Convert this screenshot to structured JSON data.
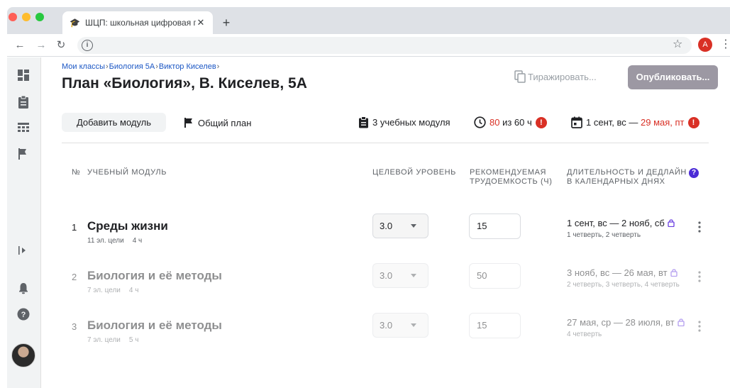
{
  "browser": {
    "tab_title": "ШЦП: школьная цифровая пл…",
    "tab_favicon": "graduate-icon",
    "profile_initial": "A",
    "profile_color": "#d93025"
  },
  "breadcrumbs": [
    {
      "label": "Мои классы"
    },
    {
      "label": "Биология 5А"
    },
    {
      "label": "Виктор Киселев"
    }
  ],
  "breadcrumb_separator": "›",
  "page_title": "План «Биология», В. Киселев, 5А",
  "actions": {
    "duplicate_label": "Тиражировать...",
    "publish_label": "Опубликовать...",
    "add_module_label": "Добавить модуль",
    "overall_plan_label": "Общий план"
  },
  "stats": {
    "modules": "3 учебных модуля",
    "hours_used": "80",
    "hours_of": "из 60 ч",
    "dates_start": "1 сент, вс —",
    "dates_end": "29 мая, пт",
    "error_mark": "!"
  },
  "table": {
    "headers": {
      "num": "№",
      "module": "Учебный модуль",
      "level": "Целевой уровень",
      "hours": "Рекомендуемая трудоемкость (ч)",
      "duration": "Длительность и дедлайн в календарных днях"
    },
    "help_mark": "?",
    "rows": [
      {
        "num": "1",
        "name": "Среды жизни",
        "goals": "11 эл. цели",
        "hours_meta": "4 ч",
        "level": "3.0",
        "hours": "15",
        "dates": "1 сент, вс — 2 нояб, сб",
        "quarters": "1 четверть, 2 четверть"
      },
      {
        "num": "2",
        "name": "Биология и её методы",
        "goals": "7 эл. цели",
        "hours_meta": "4 ч",
        "level": "3.0",
        "hours": "50",
        "dates": "3 нояб, вс — 26 мая, вт",
        "quarters": "2 четверть, 3 четверть, 4 четверть"
      },
      {
        "num": "3",
        "name": "Биология и её методы",
        "goals": "7 эл. цели",
        "hours_meta": "5 ч",
        "level": "3.0",
        "hours": "15",
        "dates": "27 мая, ср — 28 июля, вт",
        "quarters": "4 четверть"
      }
    ]
  },
  "colors": {
    "accent_link": "#1a56c4",
    "error": "#d93025",
    "publish_bg": "#9c98a3",
    "help_bg": "#4b2bd6",
    "lock": "#6a3fe0"
  }
}
